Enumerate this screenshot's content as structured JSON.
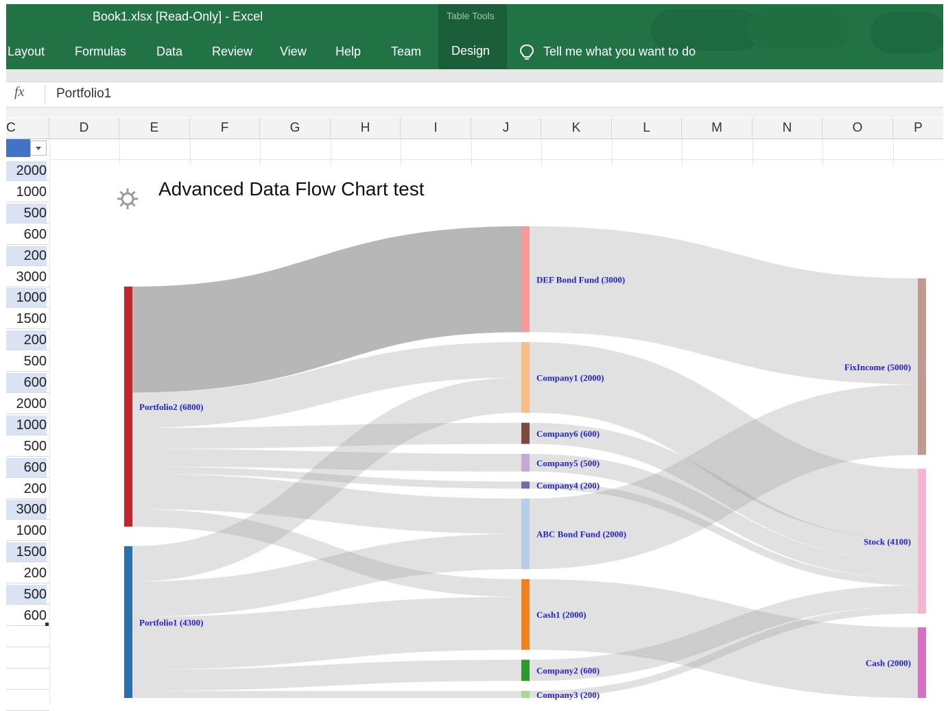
{
  "window": {
    "title": "Book1.xlsx  [Read-Only]  -  Excel",
    "context_tab_group": "Table Tools",
    "tell_me": "Tell me what you want to do"
  },
  "ribbon_tabs": [
    "Layout",
    "Formulas",
    "Data",
    "Review",
    "View",
    "Help",
    "Team",
    "Design"
  ],
  "formula_bar": {
    "fx_label": "fx",
    "value": "Portfolio1"
  },
  "column_headers": [
    "C",
    "D",
    "E",
    "F",
    "G",
    "H",
    "I",
    "J",
    "K",
    "L",
    "M",
    "N",
    "O",
    "P"
  ],
  "column_c_values": [
    "2000",
    "1000",
    "500",
    "600",
    "200",
    "3000",
    "1000",
    "1500",
    "200",
    "500",
    "600",
    "2000",
    "1000",
    "500",
    "600",
    "200",
    "3000",
    "1000",
    "1500",
    "200",
    "500",
    "600"
  ],
  "colors": {
    "ribbon": "#217346",
    "band": "#dae3f3",
    "selected_cell": "#4472c4"
  },
  "chart_data": {
    "type": "sankey",
    "title": "Advanced Data Flow Chart test",
    "nodes": [
      {
        "label": "Portfolio2 (6800)",
        "value": 6800,
        "color": "#c0262c",
        "column": 0
      },
      {
        "label": "Portfolio1 (4300)",
        "value": 4300,
        "color": "#2a70ab",
        "column": 0
      },
      {
        "label": "DEF Bond Fund (3000)",
        "value": 3000,
        "color": "#f59a9a",
        "column": 1
      },
      {
        "label": "Company1 (2000)",
        "value": 2000,
        "color": "#f8bd84",
        "column": 1
      },
      {
        "label": "Company6 (600)",
        "value": 600,
        "color": "#7a4a40",
        "column": 1
      },
      {
        "label": "Company5 (500)",
        "value": 500,
        "color": "#c4a9d5",
        "column": 1
      },
      {
        "label": "Company4 (200)",
        "value": 200,
        "color": "#7b68a9",
        "column": 1
      },
      {
        "label": "ABC Bond Fund (2000)",
        "value": 2000,
        "color": "#b7cdea",
        "column": 1
      },
      {
        "label": "Cash1 (2000)",
        "value": 2000,
        "color": "#f07f1e",
        "column": 1
      },
      {
        "label": "Company2 (600)",
        "value": 600,
        "color": "#2b9a2b",
        "column": 1
      },
      {
        "label": "Company3 (200)",
        "value": 200,
        "color": "#a6d98a",
        "column": 1
      },
      {
        "label": "FixIncome (5000)",
        "value": 5000,
        "color": "#c29a8f",
        "column": 2
      },
      {
        "label": "Stock (4100)",
        "value": 4100,
        "color": "#f4b6d2",
        "column": 2
      },
      {
        "label": "Cash (2000)",
        "value": 2000,
        "color": "#d970c2",
        "column": 2
      }
    ],
    "links": [
      {
        "source": "Portfolio2 (6800)",
        "target": "DEF Bond Fund (3000)",
        "value": 3000
      },
      {
        "source": "Portfolio2 (6800)",
        "target": "Company1 (2000)",
        "value": 1000
      },
      {
        "source": "Portfolio2 (6800)",
        "target": "Company6 (600)",
        "value": 600
      },
      {
        "source": "Portfolio2 (6800)",
        "target": "Company5 (500)",
        "value": 500
      },
      {
        "source": "Portfolio2 (6800)",
        "target": "Company4 (200)",
        "value": 200
      },
      {
        "source": "Portfolio2 (6800)",
        "target": "ABC Bond Fund (2000)",
        "value": 1000
      },
      {
        "source": "Portfolio2 (6800)",
        "target": "Cash1 (2000)",
        "value": 500
      },
      {
        "source": "Portfolio1 (4300)",
        "target": "Company1 (2000)",
        "value": 1000
      },
      {
        "source": "Portfolio1 (4300)",
        "target": "ABC Bond Fund (2000)",
        "value": 1000
      },
      {
        "source": "Portfolio1 (4300)",
        "target": "Cash1 (2000)",
        "value": 1500
      },
      {
        "source": "Portfolio1 (4300)",
        "target": "Company2 (600)",
        "value": 600
      },
      {
        "source": "Portfolio1 (4300)",
        "target": "Company3 (200)",
        "value": 200
      },
      {
        "source": "DEF Bond Fund (3000)",
        "target": "FixIncome (5000)",
        "value": 3000
      },
      {
        "source": "Company1 (2000)",
        "target": "Stock (4100)",
        "value": 2000
      },
      {
        "source": "Company6 (600)",
        "target": "Stock (4100)",
        "value": 600
      },
      {
        "source": "Company5 (500)",
        "target": "Stock (4100)",
        "value": 500
      },
      {
        "source": "Company4 (200)",
        "target": "Stock (4100)",
        "value": 200
      },
      {
        "source": "ABC Bond Fund (2000)",
        "target": "FixIncome (5000)",
        "value": 2000
      },
      {
        "source": "Cash1 (2000)",
        "target": "Cash (2000)",
        "value": 2000
      },
      {
        "source": "Company2 (600)",
        "target": "Stock (4100)",
        "value": 600
      },
      {
        "source": "Company3 (200)",
        "target": "Stock (4100)",
        "value": 200
      }
    ]
  }
}
